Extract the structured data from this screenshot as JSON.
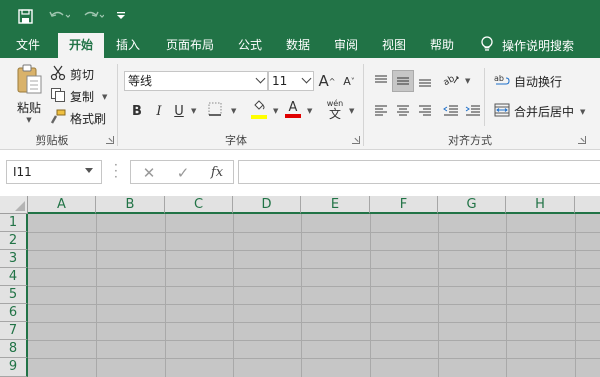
{
  "quick_access": {
    "save": "save-icon",
    "undo": "undo-icon",
    "redo": "redo-icon",
    "customize": "customize-icon"
  },
  "tabs": [
    {
      "label": "文件"
    },
    {
      "label": "开始",
      "active": true
    },
    {
      "label": "插入"
    },
    {
      "label": "页面布局"
    },
    {
      "label": "公式"
    },
    {
      "label": "数据"
    },
    {
      "label": "审阅"
    },
    {
      "label": "视图"
    },
    {
      "label": "帮助"
    }
  ],
  "tell_me": "操作说明搜索",
  "clipboard": {
    "paste": "粘贴",
    "cut": "剪切",
    "copy": "复制",
    "format_painter": "格式刷",
    "group": "剪贴板"
  },
  "font": {
    "name": "等线",
    "size": "11",
    "bold": "B",
    "italic": "I",
    "underline": "U",
    "grow": "A",
    "shrink": "A",
    "font_color": "A",
    "phonetic_top": "wén",
    "phonetic_bottom": "文",
    "group": "字体",
    "highlight_color": "#ffff00",
    "text_color": "#e00000"
  },
  "alignment": {
    "wrap_text": "自动换行",
    "merge_center": "合并后居中",
    "group": "对齐方式"
  },
  "formula_bar": {
    "name_box": "I11",
    "cancel": "✕",
    "enter": "✓",
    "fx": "fx",
    "formula": ""
  },
  "columns": [
    "A",
    "B",
    "C",
    "D",
    "E",
    "F",
    "G",
    "H"
  ],
  "rows": [
    "1",
    "2",
    "3",
    "4",
    "5",
    "6",
    "7",
    "8",
    "9"
  ],
  "colors": {
    "brand": "#217346",
    "ribbon": "#f3f3f3",
    "sheet": "#c6c6c6"
  }
}
